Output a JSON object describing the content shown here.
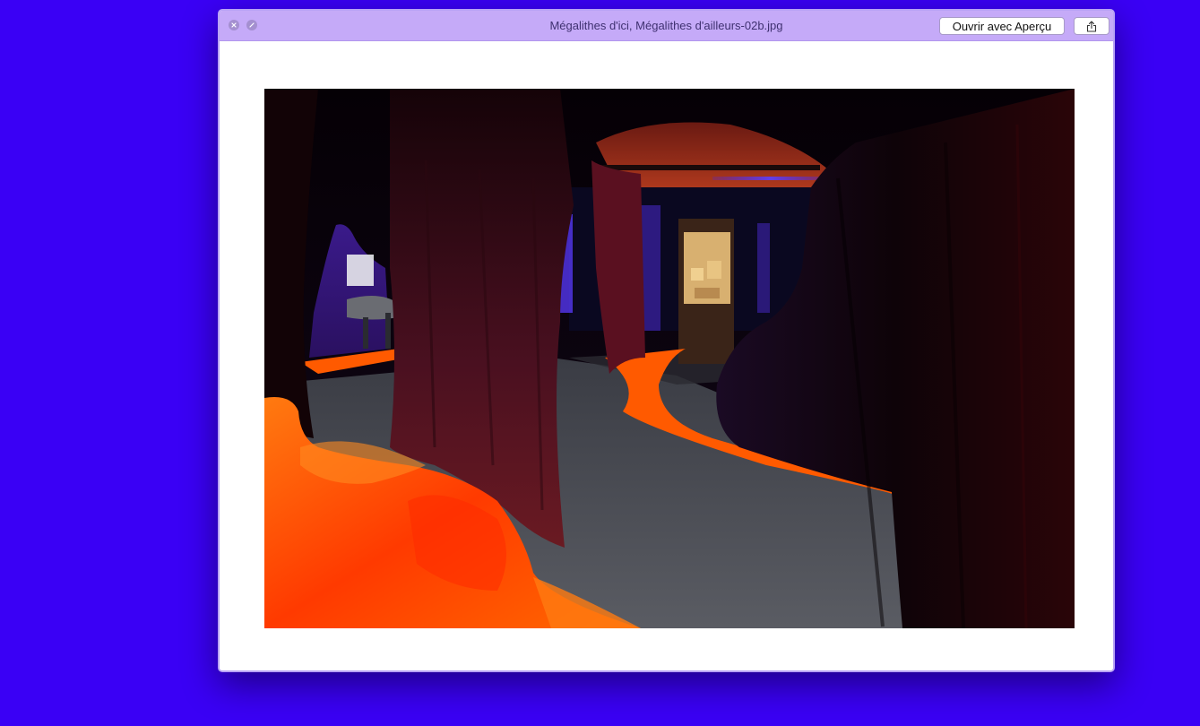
{
  "window": {
    "title": "Mégalithes d'ici, Mégalithes d'ailleurs-02b.jpg",
    "open_with_button": "Ouvrir avec Aperçu"
  },
  "icons": {
    "close": "close-icon",
    "fullscreen": "fullscreen-icon",
    "share": "share-icon"
  },
  "colors": {
    "desktop": "#3a00f5",
    "titlebar": "#c5aaf8",
    "floor_orange": "#ff5a00",
    "curtain_dark": "#4a1020",
    "accent_violet": "#4a2aa0"
  }
}
